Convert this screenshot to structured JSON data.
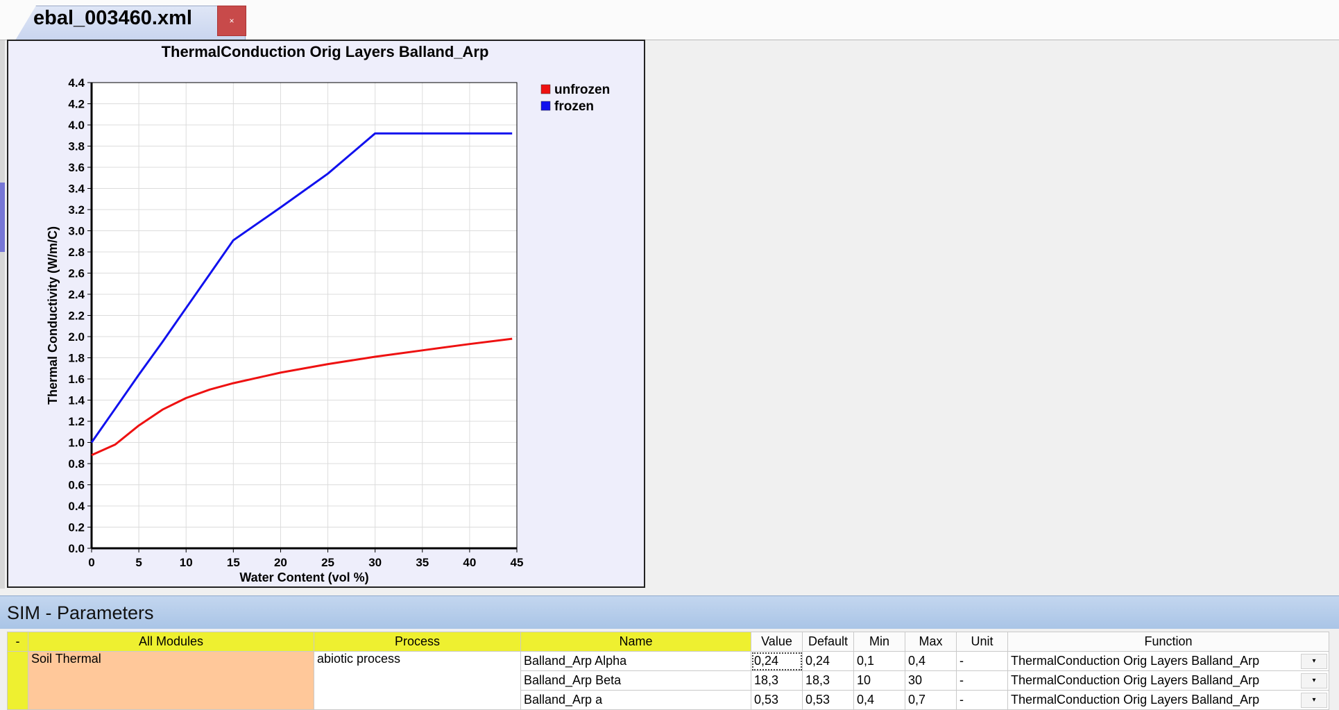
{
  "tab": {
    "title": "ebal_003460.xml",
    "close_glyph": "×"
  },
  "chart_data": {
    "type": "line",
    "title": "ThermalConduction Orig Layers Balland_Arp",
    "xlabel": "Water Content (vol %)",
    "ylabel": "Thermal Conductivity (W/m/C)",
    "xlim": [
      0,
      45
    ],
    "ylim": [
      0,
      4.4
    ],
    "grid": true,
    "legend_position": "top-right",
    "x_ticks": [
      "0",
      "5",
      "10",
      "15",
      "20",
      "25",
      "30",
      "35",
      "40",
      "45"
    ],
    "y_ticks": [
      "0.0",
      "0.2",
      "0.4",
      "0.6",
      "0.8",
      "1.0",
      "1.2",
      "1.4",
      "1.6",
      "1.8",
      "2.0",
      "2.2",
      "2.4",
      "2.6",
      "2.8",
      "3.0",
      "3.2",
      "3.4",
      "3.6",
      "3.8",
      "4.0",
      "4.2",
      "4.4"
    ],
    "x": [
      0,
      2.5,
      5,
      7.5,
      10,
      12.5,
      15,
      20,
      25,
      30,
      35,
      40,
      44.5
    ],
    "series": [
      {
        "name": "unfrozen",
        "color": "#ee1111",
        "values": [
          0.88,
          0.98,
          1.16,
          1.31,
          1.42,
          1.5,
          1.56,
          1.66,
          1.74,
          1.81,
          1.87,
          1.93,
          1.98
        ]
      },
      {
        "name": "frozen",
        "color": "#1111ee",
        "values": [
          1.0,
          1.32,
          1.64,
          1.95,
          2.27,
          2.59,
          2.91,
          3.22,
          3.54,
          3.92,
          3.92,
          3.92,
          3.92
        ]
      }
    ]
  },
  "sim": {
    "title": "SIM - Parameters"
  },
  "table": {
    "headers": {
      "dash": "-",
      "modules": "All Modules",
      "process": "Process",
      "name": "Name",
      "value": "Value",
      "default": "Default",
      "min": "Min",
      "max": "Max",
      "unit": "Unit",
      "function": "Function"
    },
    "module": "Soil Thermal",
    "process": "abiotic process",
    "rows": [
      {
        "name": "Balland_Arp Alpha",
        "value": "0,24",
        "default": "0,24",
        "min": "0,1",
        "max": "0,4",
        "unit": "-",
        "function": "ThermalConduction Orig Layers Balland_Arp"
      },
      {
        "name": "Balland_Arp Beta",
        "value": "18,3",
        "default": "18,3",
        "min": "10",
        "max": "30",
        "unit": "-",
        "function": "ThermalConduction Orig Layers Balland_Arp"
      },
      {
        "name": "Balland_Arp a",
        "value": "0,53",
        "default": "0,53",
        "min": "0,4",
        "max": "0,7",
        "unit": "-",
        "function": "ThermalConduction Orig Layers Balland_Arp"
      }
    ],
    "dropdown_glyph": "▾"
  }
}
